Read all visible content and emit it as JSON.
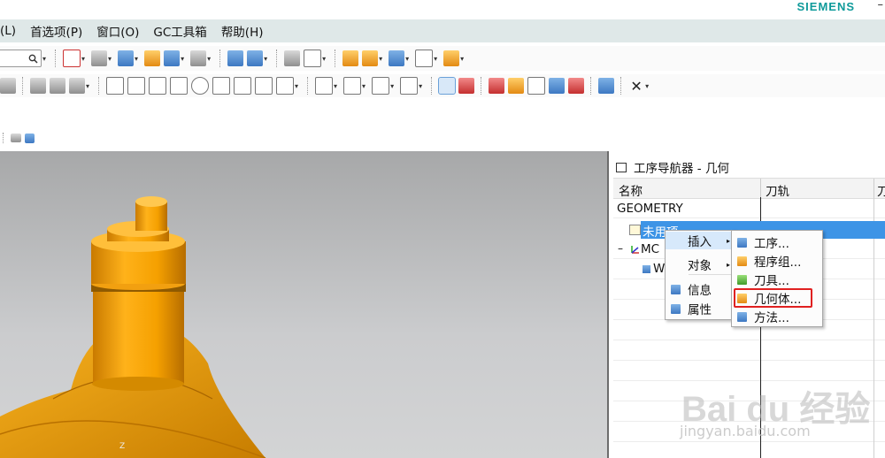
{
  "brand": "SIEMENS",
  "window_min": "–",
  "menubar": {
    "items": [
      "(L)",
      "首选项(P)",
      "窗口(O)",
      "GC工具箱",
      "帮助(H)"
    ]
  },
  "toolbar": {
    "search_icon": "search-icon",
    "dropdown_glyph": "▾",
    "close_glyph": "✕"
  },
  "viewport": {
    "axis_label": "Z",
    "model_color": "#f5a800"
  },
  "navigator": {
    "title": "工序导航器 - 几何",
    "columns": [
      "名称",
      "刀轨",
      "刀"
    ],
    "rows": {
      "geometry": "GEOMETRY",
      "unused": "未用项",
      "mcs": "MC",
      "mcs_expand": "–",
      "w": "W"
    }
  },
  "context_menu": {
    "items": [
      {
        "label": "插入",
        "icon": "insert-icon",
        "has_submenu": true
      },
      {
        "label": "对象",
        "icon": "",
        "has_submenu": true
      },
      {
        "label": "信息",
        "icon": "info-icon",
        "has_submenu": false
      },
      {
        "label": "属性",
        "icon": "properties-icon",
        "has_submenu": false
      }
    ],
    "submenu_arrow": "▸",
    "submenu": [
      {
        "label": "工序...",
        "icon": "operation-icon"
      },
      {
        "label": "程序组...",
        "icon": "program-group-icon"
      },
      {
        "label": "刀具...",
        "icon": "tool-icon"
      },
      {
        "label": "几何体...",
        "icon": "geometry-icon",
        "highlighted": true
      },
      {
        "label": "方法...",
        "icon": "method-icon"
      }
    ]
  },
  "watermark": {
    "text": "Bai du 经验",
    "sub": "jingyan.baidu.com"
  },
  "colors": {
    "selection": "#3d94e6",
    "highlight_box": "#e02020",
    "menubar_bg": "#dfe8e8"
  }
}
